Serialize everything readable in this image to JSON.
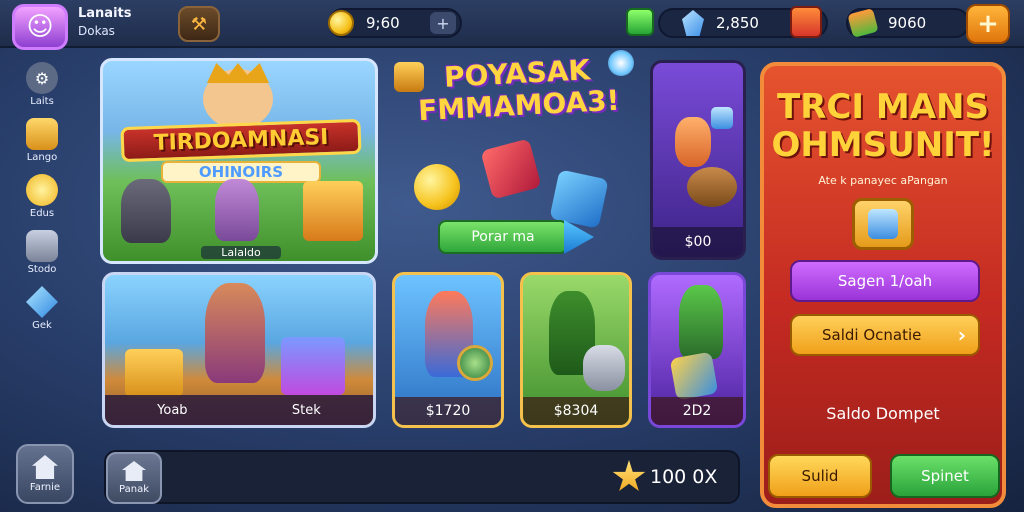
{
  "header": {
    "user_name": "Lanaits",
    "user_sub": "Dokas",
    "coins": "9;60",
    "gems": "2,850",
    "tickets": "9060"
  },
  "sidebar": {
    "items": [
      {
        "label": "Laits",
        "icon": "gear-icon"
      },
      {
        "label": "Lango",
        "icon": "chest-icon"
      },
      {
        "label": "Edus",
        "icon": "coin-icon"
      },
      {
        "label": "Stodo",
        "icon": "stone-icon"
      },
      {
        "label": "Gek",
        "icon": "gem-icon"
      }
    ],
    "home_label": "Farnie"
  },
  "hero": {
    "title": "TIRDOAMNASI",
    "subtitle": "OHINOIRS",
    "caption": "Lalaldo"
  },
  "promo": {
    "title_line1": "POYASAK",
    "title_line2": "FMMAMOA3!",
    "button_label": "Porar ma"
  },
  "cards": {
    "top_right_price": "$00",
    "wide_left_label": "Yoab",
    "wide_right_label": "Stek",
    "mini1_price": "$1720",
    "mini2_price": "$8304",
    "mini3_price": "2D2"
  },
  "right_panel": {
    "title_line1": "TRCI MANS",
    "title_line2": "OHMSUNIT!",
    "subtitle": "Ate k panayec aPangan",
    "purple_button": "Sagen 1/oah",
    "orange_button": "Saldi Ocnatie",
    "wallet_label": "Saldo Dompet",
    "saldo_button": "Sulid",
    "spin_button": "Spinet"
  },
  "bottom": {
    "shop_label": "Panak",
    "multiplier": "100 0X"
  },
  "colors": {
    "accent_gold": "#ffd23a",
    "panel_red": "#c42a22",
    "button_green": "#2fa63a",
    "button_purple": "#9a34d9"
  }
}
